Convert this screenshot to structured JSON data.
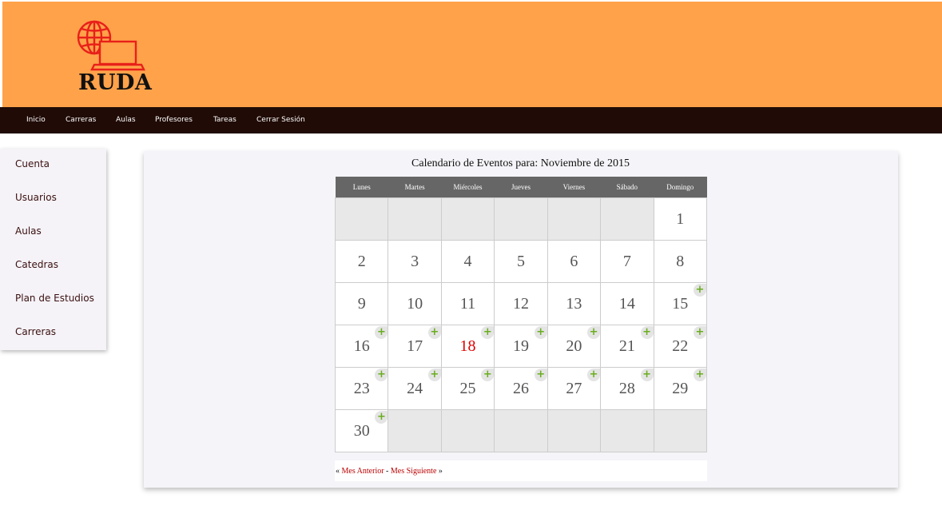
{
  "header": {
    "logo_text": "RUDA",
    "background": "#ffa24a",
    "logo_color": "#e8201a"
  },
  "nav": {
    "items": [
      "Inicio",
      "Carreras",
      "Aulas",
      "Profesores",
      "Tareas",
      "Cerrar Sesión"
    ]
  },
  "sidebar": {
    "items": [
      "Cuenta",
      "Usuarios",
      "Aulas",
      "Catedras",
      "Plan de Estudios",
      "Carreras"
    ]
  },
  "calendar": {
    "title": "Calendario de Eventos para: Noviembre de 2015",
    "weekdays": [
      "Lunes",
      "Martes",
      "Miércoles",
      "Jueves",
      "Viernes",
      "Sábado",
      "Domingo"
    ],
    "weeks": [
      [
        null,
        null,
        null,
        null,
        null,
        null,
        "1"
      ],
      [
        "2",
        "3",
        "4",
        "5",
        "6",
        "7",
        "8"
      ],
      [
        "9",
        "10",
        "11",
        "12",
        "13",
        "14",
        "15"
      ],
      [
        "16",
        "17",
        "18",
        "19",
        "20",
        "21",
        "22"
      ],
      [
        "23",
        "24",
        "25",
        "26",
        "27",
        "28",
        "29"
      ],
      [
        "30",
        null,
        null,
        null,
        null,
        null,
        null
      ]
    ],
    "today": "18",
    "add_from": "15",
    "add_icon": "+",
    "today_color": "#e00000",
    "add_icon_color": "#6aad1e"
  },
  "pager": {
    "open": "«",
    "prev_label": "Mes Anterior",
    "separator": " - ",
    "next_label": "Mes Siguiente",
    "close": "»"
  }
}
